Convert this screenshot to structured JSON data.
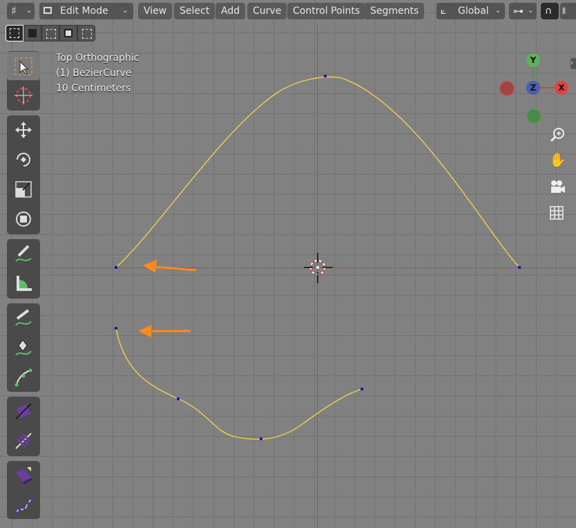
{
  "header": {
    "editor_type_icon": "grid-icon",
    "mode": "Edit Mode",
    "menus": [
      "View",
      "Select",
      "Add",
      "Curve",
      "Control Points",
      "Segments"
    ],
    "transform_orientation": "Global"
  },
  "viewport": {
    "view_name": "Top Orthographic",
    "object_name": "(1) BezierCurve",
    "grid_scale": "10 Centimeters",
    "gizmo": {
      "y": "Y",
      "z": "Z",
      "x": "X"
    },
    "colors": {
      "curve": "#f2d04a",
      "arrow": "#ff8a1c",
      "x_axis": "#b34a4a",
      "y_axis": "#4f7a4f",
      "background": "#818181"
    }
  },
  "toolbar": {
    "tools": [
      "select-box",
      "cursor",
      "move",
      "rotate",
      "scale",
      "transform",
      "annotate",
      "measure",
      "draw",
      "pen",
      "curve-pen",
      "radius",
      "tilt",
      "extrude",
      "randomize"
    ]
  }
}
